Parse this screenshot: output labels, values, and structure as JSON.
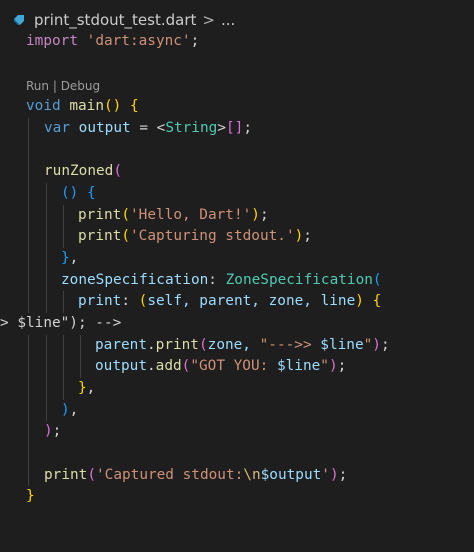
{
  "breadcrumb": {
    "file_icon": "dart-file-icon",
    "file_name": "print_stdout_test.dart",
    "separator": ">",
    "more": "..."
  },
  "codelens": {
    "run": "Run",
    "sep": " | ",
    "debug": "Debug"
  },
  "colors": {
    "background": "#1e1e1e",
    "keyword": "#569cd6",
    "control_keyword": "#c586c0",
    "function": "#dcdcaa",
    "string": "#ce9178",
    "type": "#4ec9b0",
    "variable": "#9cdcfe",
    "bracket_level1": "#ffd700",
    "bracket_level2": "#da70d6",
    "bracket_level3": "#179fff"
  },
  "code": {
    "l1": [
      "import",
      " ",
      "'dart:async'",
      ";"
    ],
    "l3": [
      "void",
      " ",
      "main",
      "(",
      ")",
      " ",
      "{"
    ],
    "l4": [
      "var",
      " ",
      "output",
      " = <",
      "String",
      ">",
      "[",
      "]",
      ";"
    ],
    "l6": [
      "runZoned",
      "("
    ],
    "l7": [
      "(",
      ")",
      " ",
      "{"
    ],
    "l8": [
      "print",
      "(",
      "'Hello, Dart!'",
      ")",
      ";"
    ],
    "l9": [
      "print",
      "(",
      "'Capturing stdout.'",
      ")",
      ";"
    ],
    "l10": [
      "}",
      ","
    ],
    "l11": [
      "zoneSpecification",
      ": ",
      "ZoneSpecification",
      "("
    ],
    "l12": [
      "print",
      ": ",
      "(",
      "self, parent, zone, line",
      ")",
      " ",
      "{"
    ],
    "l13": [
      "parent",
      ".",
      "print",
      "(",
      "zone, ",
      "\"--->> ",
      "$line",
      "\"",
      ")",
      ";"
    ],
    "l14": [
      "output",
      ".",
      "add",
      "(",
      "\"GOT YOU: ",
      "$line",
      "\"",
      ")",
      ";"
    ],
    "l15": [
      "}",
      ","
    ],
    "l16": [
      ")",
      ","
    ],
    "l17": [
      ")",
      ";"
    ],
    "l19": [
      "print",
      "(",
      "'Captured stdout:",
      "\\n",
      "$output",
      "'",
      ")",
      ";"
    ],
    "l20": [
      "}"
    ]
  }
}
